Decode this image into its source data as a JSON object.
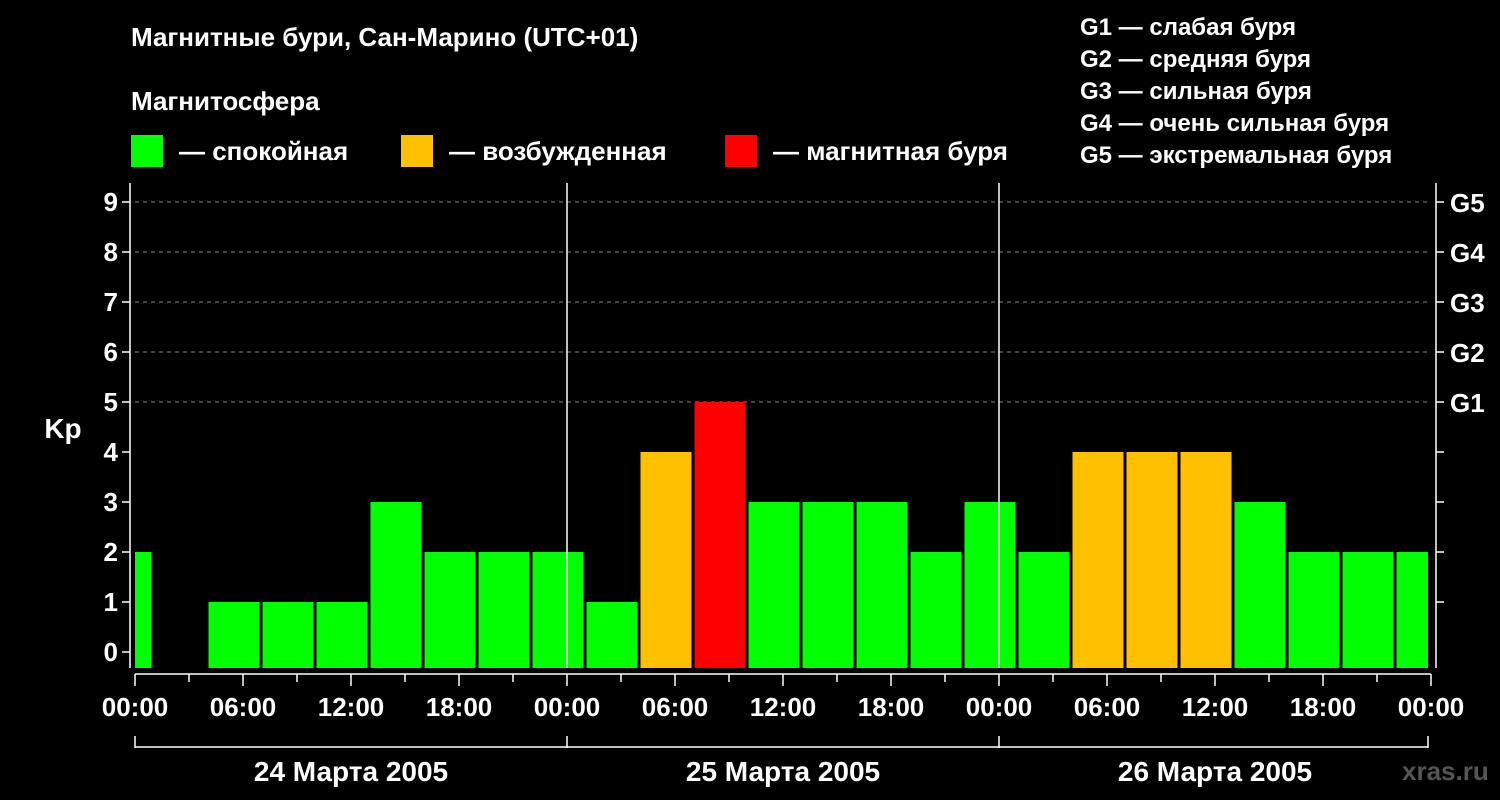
{
  "header": {
    "title": "Магнитные бури, Сан-Марино (UTC+01)",
    "subtitle": "Магнитосфера"
  },
  "legend": [
    {
      "label": "— спокойная",
      "color": "#00ff00"
    },
    {
      "label": "— возбужденная",
      "color": "#ffc000"
    },
    {
      "label": "— магнитная буря",
      "color": "#ff0000"
    }
  ],
  "storm_scale": [
    "G1 — слабая буря",
    "G2 — средняя буря",
    "G3 — сильная буря",
    "G4 — очень сильная буря",
    "G5 — экстремальная буря"
  ],
  "watermark": "xras.ru",
  "colors": {
    "background": "#000000",
    "calm": "#00ff00",
    "active": "#ffc000",
    "storm": "#ff0000",
    "axis": "#ffffff",
    "grid": "#888888"
  },
  "chart_data": {
    "type": "bar",
    "ylabel": "Kp",
    "ylim": [
      0,
      9
    ],
    "yticks": [
      0,
      1,
      2,
      3,
      4,
      5,
      6,
      7,
      8,
      9
    ],
    "right_ticks": [
      {
        "value": 5,
        "label": "G1"
      },
      {
        "value": 6,
        "label": "G2"
      },
      {
        "value": 7,
        "label": "G3"
      },
      {
        "value": 8,
        "label": "G4"
      },
      {
        "value": 9,
        "label": "G5"
      }
    ],
    "dashed_grid_at": [
      5,
      6,
      7,
      8,
      9
    ],
    "x_range_hours": [
      0,
      72
    ],
    "xtick_labels": [
      "00:00",
      "06:00",
      "12:00",
      "18:00",
      "00:00",
      "06:00",
      "12:00",
      "18:00",
      "00:00",
      "06:00",
      "12:00",
      "18:00",
      "00:00"
    ],
    "day_labels": [
      "24 Марта 2005",
      "25 Марта 2005",
      "26 Марта 2005"
    ],
    "bars": [
      {
        "start": 0,
        "end": 1,
        "value": 2,
        "level": "calm"
      },
      {
        "start": 1,
        "end": 4,
        "value": 0,
        "level": "calm"
      },
      {
        "start": 4,
        "end": 7,
        "value": 1,
        "level": "calm"
      },
      {
        "start": 7,
        "end": 10,
        "value": 1,
        "level": "calm"
      },
      {
        "start": 10,
        "end": 13,
        "value": 1,
        "level": "calm"
      },
      {
        "start": 13,
        "end": 16,
        "value": 3,
        "level": "calm"
      },
      {
        "start": 16,
        "end": 19,
        "value": 2,
        "level": "calm"
      },
      {
        "start": 19,
        "end": 22,
        "value": 2,
        "level": "calm"
      },
      {
        "start": 22,
        "end": 25,
        "value": 2,
        "level": "calm"
      },
      {
        "start": 25,
        "end": 28,
        "value": 1,
        "level": "calm"
      },
      {
        "start": 28,
        "end": 31,
        "value": 4,
        "level": "active"
      },
      {
        "start": 31,
        "end": 34,
        "value": 5,
        "level": "storm"
      },
      {
        "start": 34,
        "end": 37,
        "value": 3,
        "level": "calm"
      },
      {
        "start": 37,
        "end": 40,
        "value": 3,
        "level": "calm"
      },
      {
        "start": 40,
        "end": 43,
        "value": 3,
        "level": "calm"
      },
      {
        "start": 43,
        "end": 46,
        "value": 2,
        "level": "calm"
      },
      {
        "start": 46,
        "end": 49,
        "value": 3,
        "level": "calm"
      },
      {
        "start": 49,
        "end": 52,
        "value": 2,
        "level": "calm"
      },
      {
        "start": 52,
        "end": 55,
        "value": 4,
        "level": "active"
      },
      {
        "start": 55,
        "end": 58,
        "value": 4,
        "level": "active"
      },
      {
        "start": 58,
        "end": 61,
        "value": 4,
        "level": "active"
      },
      {
        "start": 61,
        "end": 64,
        "value": 3,
        "level": "calm"
      },
      {
        "start": 64,
        "end": 67,
        "value": 2,
        "level": "calm"
      },
      {
        "start": 67,
        "end": 70,
        "value": 2,
        "level": "calm"
      },
      {
        "start": 70,
        "end": 72,
        "value": 2,
        "level": "calm"
      }
    ]
  }
}
